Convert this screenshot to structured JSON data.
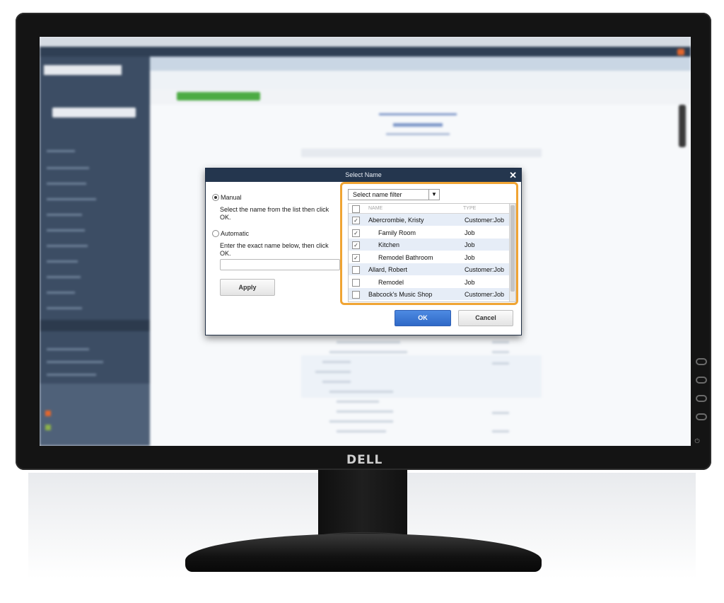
{
  "monitor": {
    "brand": "DELL",
    "power_symbol": "⏻"
  },
  "dialog": {
    "title": "Select Name",
    "close_glyph": "✕",
    "manual": {
      "label": "Manual",
      "description": "Select the name from the list then click OK.",
      "selected": true
    },
    "automatic": {
      "label": "Automatic",
      "description": "Enter the exact name below, then click OK.",
      "selected": false,
      "input_value": ""
    },
    "apply_label": "Apply",
    "filter": {
      "label": "Select name filter",
      "arrow": "▼"
    },
    "list": {
      "columns": {
        "name": "NAME",
        "type": "TYPE"
      },
      "rows": [
        {
          "name": "Abercrombie, Kristy",
          "type": "Customer:Job",
          "checked": true,
          "indent": 0
        },
        {
          "name": "Family Room",
          "type": "Job",
          "checked": true,
          "indent": 1
        },
        {
          "name": "Kitchen",
          "type": "Job",
          "checked": true,
          "indent": 1
        },
        {
          "name": "Remodel Bathroom",
          "type": "Job",
          "checked": true,
          "indent": 1
        },
        {
          "name": "Allard, Robert",
          "type": "Customer:Job",
          "checked": false,
          "indent": 0
        },
        {
          "name": "Remodel",
          "type": "Job",
          "checked": false,
          "indent": 1
        },
        {
          "name": "Babcock's Music Shop",
          "type": "Customer:Job",
          "checked": false,
          "indent": 0
        }
      ]
    },
    "ok_label": "OK",
    "cancel_label": "Cancel"
  },
  "colors": {
    "highlight_border": "#f0a433",
    "ok_button": "#2f69c7",
    "titlebar": "#24364e"
  }
}
